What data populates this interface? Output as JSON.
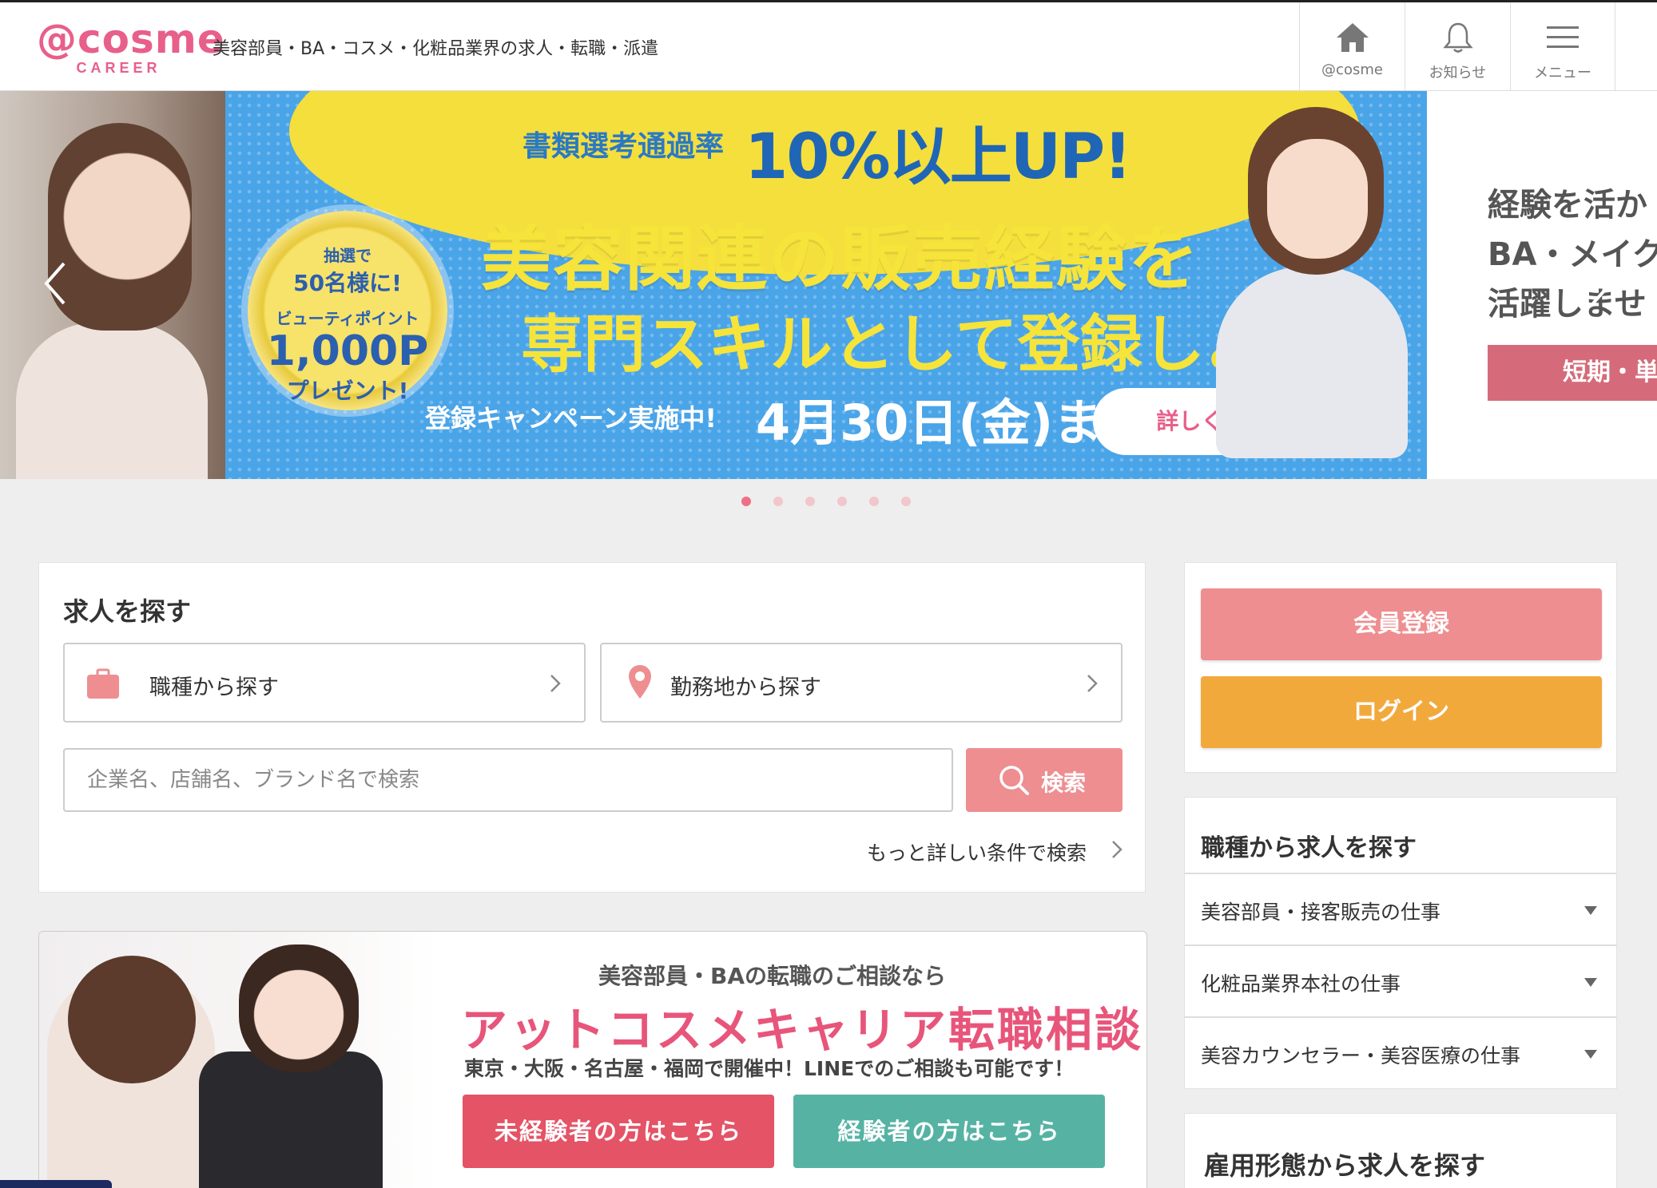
{
  "header": {
    "logo_main": "@cosme",
    "logo_sub": "CAREER",
    "tagline": "美容部員・BA・コスメ・化粧品業界の求人・転職・派遣",
    "nav": [
      {
        "label": "@cosme",
        "icon": "home-icon"
      },
      {
        "label": "お知らせ",
        "icon": "bell-icon"
      },
      {
        "label": "メニュー",
        "icon": "hamburger-menu-icon"
      }
    ]
  },
  "carousel": {
    "main_slide": {
      "bubble_sub": "書類選考通過率",
      "bubble_big": "10%以上UP!",
      "coin_line1": "抽選で",
      "coin_line2": "50名様に!",
      "coin_line3": "ビューティポイント",
      "coin_line4": "1,000P",
      "coin_line5": "プレゼント!",
      "headline1": "美容関連の販売経験を",
      "headline2": "専門スキルとして登録しよう!",
      "campaign": "登録キャンペーン実施中!",
      "deadline": "4月30日(金)まで",
      "cta": "詳しくはこちら ›"
    },
    "right_slide": {
      "line1": "経験を活か",
      "line2": "BA・メイク",
      "line3": "活躍しませ",
      "bar": "短期・単"
    },
    "dot_count": 6,
    "active_dot": 0
  },
  "search": {
    "title": "求人を探す",
    "job_type_label": "職種から探す",
    "location_label": "勤務地から探す",
    "keyword_placeholder": "企業名、店舗名、ブランド名で検索",
    "search_button": "検索",
    "advanced_link": "もっと詳しい条件で検索"
  },
  "consult_banner": {
    "lead": "美容部員・BAの転職のご相談なら",
    "headline": "アットコスメキャリア転職相談",
    "sub": "東京・大阪・名古屋・福岡で開催中！LINEでのご相談も可能です！",
    "novice_button": "未経験者の方はこちら",
    "experienced_button": "経験者の方はこちら"
  },
  "auth": {
    "register": "会員登録",
    "login": "ログイン"
  },
  "job_categories": {
    "title": "職種から求人を探す",
    "items": [
      "美容部員・接客販売の仕事",
      "化粧品業界本社の仕事",
      "美容カウンセラー・美容医療の仕事"
    ]
  },
  "employment": {
    "title": "雇用形態から求人を探す"
  },
  "colors": {
    "brand_pink": "#e85f8a",
    "register": "#ee8e91",
    "login": "#f2a93c",
    "novice": "#e45366",
    "experienced": "#56b3a4"
  }
}
